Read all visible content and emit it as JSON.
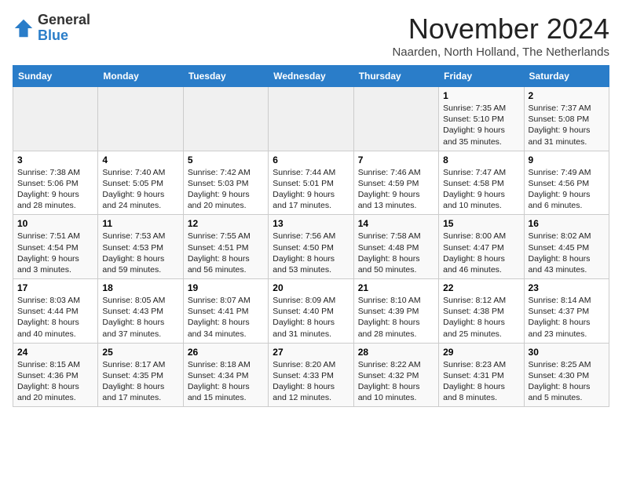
{
  "logo": {
    "text_general": "General",
    "text_blue": "Blue"
  },
  "header": {
    "month": "November 2024",
    "location": "Naarden, North Holland, The Netherlands"
  },
  "weekdays": [
    "Sunday",
    "Monday",
    "Tuesday",
    "Wednesday",
    "Thursday",
    "Friday",
    "Saturday"
  ],
  "weeks": [
    [
      {
        "day": "",
        "info": ""
      },
      {
        "day": "",
        "info": ""
      },
      {
        "day": "",
        "info": ""
      },
      {
        "day": "",
        "info": ""
      },
      {
        "day": "",
        "info": ""
      },
      {
        "day": "1",
        "info": "Sunrise: 7:35 AM\nSunset: 5:10 PM\nDaylight: 9 hours and 35 minutes."
      },
      {
        "day": "2",
        "info": "Sunrise: 7:37 AM\nSunset: 5:08 PM\nDaylight: 9 hours and 31 minutes."
      }
    ],
    [
      {
        "day": "3",
        "info": "Sunrise: 7:38 AM\nSunset: 5:06 PM\nDaylight: 9 hours and 28 minutes."
      },
      {
        "day": "4",
        "info": "Sunrise: 7:40 AM\nSunset: 5:05 PM\nDaylight: 9 hours and 24 minutes."
      },
      {
        "day": "5",
        "info": "Sunrise: 7:42 AM\nSunset: 5:03 PM\nDaylight: 9 hours and 20 minutes."
      },
      {
        "day": "6",
        "info": "Sunrise: 7:44 AM\nSunset: 5:01 PM\nDaylight: 9 hours and 17 minutes."
      },
      {
        "day": "7",
        "info": "Sunrise: 7:46 AM\nSunset: 4:59 PM\nDaylight: 9 hours and 13 minutes."
      },
      {
        "day": "8",
        "info": "Sunrise: 7:47 AM\nSunset: 4:58 PM\nDaylight: 9 hours and 10 minutes."
      },
      {
        "day": "9",
        "info": "Sunrise: 7:49 AM\nSunset: 4:56 PM\nDaylight: 9 hours and 6 minutes."
      }
    ],
    [
      {
        "day": "10",
        "info": "Sunrise: 7:51 AM\nSunset: 4:54 PM\nDaylight: 9 hours and 3 minutes."
      },
      {
        "day": "11",
        "info": "Sunrise: 7:53 AM\nSunset: 4:53 PM\nDaylight: 8 hours and 59 minutes."
      },
      {
        "day": "12",
        "info": "Sunrise: 7:55 AM\nSunset: 4:51 PM\nDaylight: 8 hours and 56 minutes."
      },
      {
        "day": "13",
        "info": "Sunrise: 7:56 AM\nSunset: 4:50 PM\nDaylight: 8 hours and 53 minutes."
      },
      {
        "day": "14",
        "info": "Sunrise: 7:58 AM\nSunset: 4:48 PM\nDaylight: 8 hours and 50 minutes."
      },
      {
        "day": "15",
        "info": "Sunrise: 8:00 AM\nSunset: 4:47 PM\nDaylight: 8 hours and 46 minutes."
      },
      {
        "day": "16",
        "info": "Sunrise: 8:02 AM\nSunset: 4:45 PM\nDaylight: 8 hours and 43 minutes."
      }
    ],
    [
      {
        "day": "17",
        "info": "Sunrise: 8:03 AM\nSunset: 4:44 PM\nDaylight: 8 hours and 40 minutes."
      },
      {
        "day": "18",
        "info": "Sunrise: 8:05 AM\nSunset: 4:43 PM\nDaylight: 8 hours and 37 minutes."
      },
      {
        "day": "19",
        "info": "Sunrise: 8:07 AM\nSunset: 4:41 PM\nDaylight: 8 hours and 34 minutes."
      },
      {
        "day": "20",
        "info": "Sunrise: 8:09 AM\nSunset: 4:40 PM\nDaylight: 8 hours and 31 minutes."
      },
      {
        "day": "21",
        "info": "Sunrise: 8:10 AM\nSunset: 4:39 PM\nDaylight: 8 hours and 28 minutes."
      },
      {
        "day": "22",
        "info": "Sunrise: 8:12 AM\nSunset: 4:38 PM\nDaylight: 8 hours and 25 minutes."
      },
      {
        "day": "23",
        "info": "Sunrise: 8:14 AM\nSunset: 4:37 PM\nDaylight: 8 hours and 23 minutes."
      }
    ],
    [
      {
        "day": "24",
        "info": "Sunrise: 8:15 AM\nSunset: 4:36 PM\nDaylight: 8 hours and 20 minutes."
      },
      {
        "day": "25",
        "info": "Sunrise: 8:17 AM\nSunset: 4:35 PM\nDaylight: 8 hours and 17 minutes."
      },
      {
        "day": "26",
        "info": "Sunrise: 8:18 AM\nSunset: 4:34 PM\nDaylight: 8 hours and 15 minutes."
      },
      {
        "day": "27",
        "info": "Sunrise: 8:20 AM\nSunset: 4:33 PM\nDaylight: 8 hours and 12 minutes."
      },
      {
        "day": "28",
        "info": "Sunrise: 8:22 AM\nSunset: 4:32 PM\nDaylight: 8 hours and 10 minutes."
      },
      {
        "day": "29",
        "info": "Sunrise: 8:23 AM\nSunset: 4:31 PM\nDaylight: 8 hours and 8 minutes."
      },
      {
        "day": "30",
        "info": "Sunrise: 8:25 AM\nSunset: 4:30 PM\nDaylight: 8 hours and 5 minutes."
      }
    ]
  ]
}
